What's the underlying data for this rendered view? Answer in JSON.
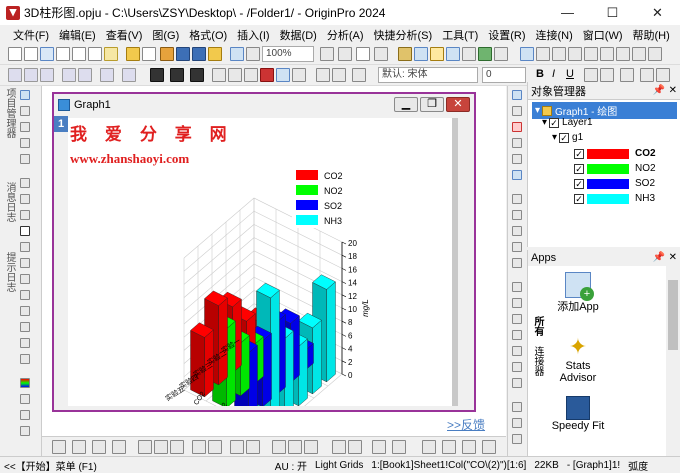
{
  "window": {
    "title": "3D柱形图.opju - C:\\Users\\ZSY\\Desktop\\ - /Folder1/ - OriginPro 2024",
    "min": "—",
    "max": "☐",
    "close": "✕"
  },
  "menu": [
    "文件(F)",
    "编辑(E)",
    "查看(V)",
    "图(G)",
    "格式(O)",
    "插入(I)",
    "数据(D)",
    "分析(A)",
    "快捷分析(S)",
    "工具(T)",
    "设置(R)",
    "连接(N)",
    "窗口(W)",
    "帮助(H)"
  ],
  "toolbar": {
    "zoom": "100%",
    "font": "默认: 宋体",
    "size": "0",
    "bold": "B",
    "italic": "I",
    "underline": "U"
  },
  "graph": {
    "title": "Graph1",
    "layer_badge": "1",
    "watermark_cn": "我 爱 分 享 网",
    "watermark_url": "www.zhanshaoyi.com",
    "feedback": ">>反馈"
  },
  "chart_data": {
    "type": "bar",
    "subtype": "3d",
    "categories": [
      "实验一",
      "实验二",
      "实验三",
      "实验四",
      "实验五"
    ],
    "series": [
      {
        "name": "CO2",
        "color": "#ff0000",
        "values": [
          4,
          6,
          10,
          12,
          9
        ]
      },
      {
        "name": "NO2",
        "color": "#00ff00",
        "values": [
          3,
          7,
          6,
          8,
          12
        ]
      },
      {
        "name": "SO2",
        "color": "#0000ff",
        "values": [
          3,
          9,
          11,
          10,
          10
        ]
      },
      {
        "name": "NH3",
        "color": "#00ffff",
        "values": [
          14,
          10,
          9,
          12,
          20
        ]
      }
    ],
    "ylabel": "mg/L",
    "ylim": [
      0,
      20
    ],
    "yticks": [
      "0",
      "2",
      "4",
      "6",
      "8",
      "10",
      "12",
      "14",
      "16",
      "18",
      "20"
    ],
    "legend": {
      "position": "top-right",
      "labels": [
        "CO2",
        "NO2",
        "SO2",
        "NH3"
      ]
    },
    "grid": true
  },
  "object_manager": {
    "title": "对象管理器",
    "graph": "Graph1 - 绘图",
    "layer": "Layer1",
    "group": "g1",
    "items": [
      "CO2",
      "NO2",
      "SO2",
      "NH3"
    ],
    "colors": [
      "#ff0000",
      "#00ff00",
      "#0000ff",
      "#00ffff"
    ]
  },
  "apps": {
    "title": "Apps",
    "items": [
      "添加App",
      "Stats Advisor",
      "Speedy Fit"
    ],
    "tabs": [
      "所有",
      "连接器"
    ]
  },
  "side_tabs": [
    "项目管理器",
    "消息日志",
    "提示日志"
  ],
  "status": {
    "start": "<<【开始】菜单 (F1)",
    "au": "AU : 开",
    "grids": "Light Grids",
    "book": "1:[Book1]Sheet1!Col(\"CO\\(2)\")[1:6]",
    "size": "22KB",
    "graph": "- [Graph1]1!",
    "unit": "弧度"
  }
}
